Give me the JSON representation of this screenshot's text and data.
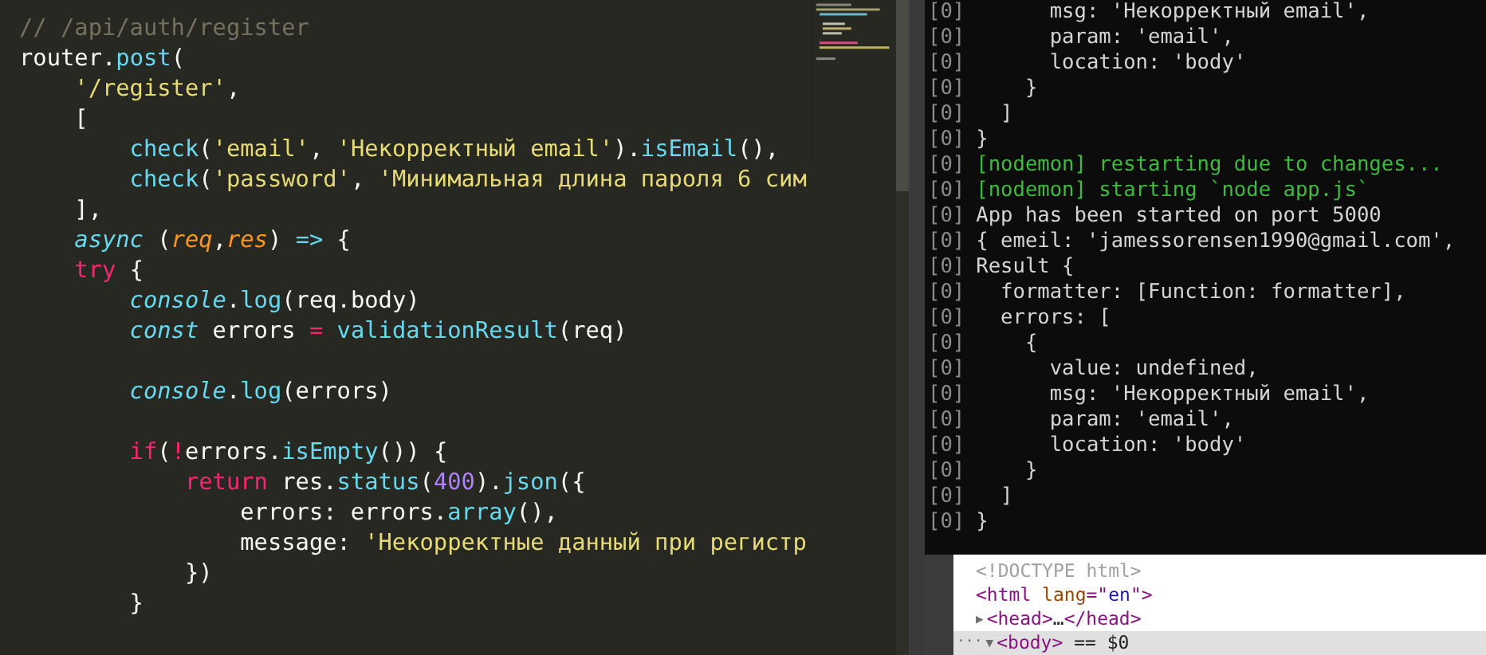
{
  "editor": {
    "lines": [
      {
        "kind": "code",
        "tokens": [
          {
            "kind": "comment",
            "text": "// /api/auth/register"
          }
        ]
      },
      {
        "kind": "code",
        "tokens": [
          {
            "kind": "plain",
            "text": "router."
          },
          {
            "kind": "func",
            "text": "post"
          },
          {
            "kind": "plain",
            "text": "("
          }
        ]
      },
      {
        "kind": "code",
        "tokens": [
          {
            "kind": "string",
            "text": "    '/register'"
          },
          {
            "kind": "plain",
            "text": ","
          }
        ]
      },
      {
        "kind": "code",
        "tokens": [
          {
            "kind": "plain",
            "text": "    ["
          }
        ]
      },
      {
        "kind": "code",
        "tokens": [
          {
            "kind": "func",
            "text": "        check"
          },
          {
            "kind": "plain",
            "text": "("
          },
          {
            "kind": "string",
            "text": "'email'"
          },
          {
            "kind": "plain",
            "text": ", "
          },
          {
            "kind": "string",
            "text": "'Некорректный email'"
          },
          {
            "kind": "plain",
            "text": ")."
          },
          {
            "kind": "func",
            "text": "isEmail"
          },
          {
            "kind": "plain",
            "text": "(),"
          }
        ]
      },
      {
        "kind": "code",
        "tokens": [
          {
            "kind": "func",
            "text": "        check"
          },
          {
            "kind": "plain",
            "text": "("
          },
          {
            "kind": "string",
            "text": "'password'"
          },
          {
            "kind": "plain",
            "text": ", "
          },
          {
            "kind": "string",
            "text": "'Минимальная длина пароля 6 сим"
          }
        ]
      },
      {
        "kind": "code",
        "tokens": [
          {
            "kind": "plain",
            "text": "    ],"
          }
        ]
      },
      {
        "kind": "code",
        "tokens": [
          {
            "kind": "storage",
            "text": "    async"
          },
          {
            "kind": "plain",
            "text": " ("
          },
          {
            "kind": "param",
            "text": "req"
          },
          {
            "kind": "plain",
            "text": ","
          },
          {
            "kind": "param",
            "text": "res"
          },
          {
            "kind": "plain",
            "text": ") "
          },
          {
            "kind": "storage-plain",
            "text": "=>"
          },
          {
            "kind": "plain",
            "text": " {"
          }
        ]
      },
      {
        "kind": "code",
        "tokens": [
          {
            "kind": "keyword",
            "text": "    try"
          },
          {
            "kind": "plain",
            "text": " {"
          }
        ]
      },
      {
        "kind": "code",
        "tokens": [
          {
            "kind": "storage",
            "text": "        console"
          },
          {
            "kind": "plain",
            "text": "."
          },
          {
            "kind": "func",
            "text": "log"
          },
          {
            "kind": "plain",
            "text": "(req.body)"
          }
        ]
      },
      {
        "kind": "code",
        "tokens": [
          {
            "kind": "storage",
            "text": "        const"
          },
          {
            "kind": "plain",
            "text": " errors "
          },
          {
            "kind": "keyword",
            "text": "="
          },
          {
            "kind": "func",
            "text": " validationResult"
          },
          {
            "kind": "plain",
            "text": "(req)"
          }
        ]
      },
      {
        "kind": "blank"
      },
      {
        "kind": "code",
        "tokens": [
          {
            "kind": "storage",
            "text": "        console"
          },
          {
            "kind": "plain",
            "text": "."
          },
          {
            "kind": "func",
            "text": "log"
          },
          {
            "kind": "plain",
            "text": "(errors)"
          }
        ]
      },
      {
        "kind": "blank"
      },
      {
        "kind": "code",
        "tokens": [
          {
            "kind": "keyword",
            "text": "        if"
          },
          {
            "kind": "plain",
            "text": "("
          },
          {
            "kind": "keyword",
            "text": "!"
          },
          {
            "kind": "plain",
            "text": "errors."
          },
          {
            "kind": "func",
            "text": "isEmpty"
          },
          {
            "kind": "plain",
            "text": "()) {"
          }
        ]
      },
      {
        "kind": "code",
        "tokens": [
          {
            "kind": "keyword",
            "text": "            return"
          },
          {
            "kind": "plain",
            "text": " res."
          },
          {
            "kind": "func",
            "text": "status"
          },
          {
            "kind": "plain",
            "text": "("
          },
          {
            "kind": "number",
            "text": "400"
          },
          {
            "kind": "plain",
            "text": ")."
          },
          {
            "kind": "func",
            "text": "json"
          },
          {
            "kind": "plain",
            "text": "({"
          }
        ]
      },
      {
        "kind": "code",
        "tokens": [
          {
            "kind": "plain",
            "text": "                errors: errors."
          },
          {
            "kind": "func",
            "text": "array"
          },
          {
            "kind": "plain",
            "text": "(),"
          }
        ]
      },
      {
        "kind": "code",
        "tokens": [
          {
            "kind": "plain",
            "text": "                message: "
          },
          {
            "kind": "string",
            "text": "'Некорректные данный при регистр"
          }
        ]
      },
      {
        "kind": "code",
        "tokens": [
          {
            "kind": "plain",
            "text": "            })"
          }
        ]
      },
      {
        "kind": "code",
        "tokens": [
          {
            "kind": "plain",
            "text": "        }"
          }
        ]
      }
    ]
  },
  "terminal": {
    "lines": [
      {
        "prefix": "[0]",
        "text": "      msg: 'Некорректный email',",
        "kind": "log"
      },
      {
        "prefix": "[0]",
        "text": "      param: 'email',",
        "kind": "log"
      },
      {
        "prefix": "[0]",
        "text": "      location: 'body'",
        "kind": "log"
      },
      {
        "prefix": "[0]",
        "text": "    }",
        "kind": "log"
      },
      {
        "prefix": "[0]",
        "text": "  ]",
        "kind": "log"
      },
      {
        "prefix": "[0]",
        "text": "}",
        "kind": "log"
      },
      {
        "prefix": "[0]",
        "text": "[nodemon] restarting due to changes...",
        "kind": "nodemon"
      },
      {
        "prefix": "[0]",
        "text": "[nodemon] starting `node app.js`",
        "kind": "nodemon"
      },
      {
        "prefix": "[0]",
        "text": "App has been started on port 5000",
        "kind": "log"
      },
      {
        "prefix": "[0]",
        "text": "{ emeil: 'jamessorensen1990@gmail.com',",
        "kind": "log"
      },
      {
        "prefix": "[0]",
        "text": "Result {",
        "kind": "log"
      },
      {
        "prefix": "[0]",
        "text": "  formatter: [Function: formatter],",
        "kind": "log"
      },
      {
        "prefix": "[0]",
        "text": "  errors: [",
        "kind": "log"
      },
      {
        "prefix": "[0]",
        "text": "    {",
        "kind": "log"
      },
      {
        "prefix": "[0]",
        "text": "      value: undefined,",
        "kind": "log"
      },
      {
        "prefix": "[0]",
        "text": "      msg: 'Некорректный email',",
        "kind": "log"
      },
      {
        "prefix": "[0]",
        "text": "      param: 'email',",
        "kind": "log"
      },
      {
        "prefix": "[0]",
        "text": "      location: 'body'",
        "kind": "log"
      },
      {
        "prefix": "[0]",
        "text": "    }",
        "kind": "log"
      },
      {
        "prefix": "[0]",
        "text": "  ]",
        "kind": "log"
      },
      {
        "prefix": "[0]",
        "text": "}",
        "kind": "log"
      }
    ]
  },
  "devtools": {
    "nodes": [
      {
        "selected": false,
        "tokens": [
          {
            "kind": "doctype",
            "text": "<!DOCTYPE html>"
          }
        ]
      },
      {
        "selected": false,
        "tokens": [
          {
            "kind": "tag",
            "text": "<html "
          },
          {
            "kind": "attr",
            "text": "lang"
          },
          {
            "kind": "tag",
            "text": "=\""
          },
          {
            "kind": "value",
            "text": "en"
          },
          {
            "kind": "tag",
            "text": "\">"
          }
        ]
      },
      {
        "selected": false,
        "toggle": "▶",
        "tokens": [
          {
            "kind": "tag",
            "text": "<head>"
          },
          {
            "kind": "plain",
            "text": "…"
          },
          {
            "kind": "tag",
            "text": "</head>"
          }
        ]
      },
      {
        "selected": true,
        "dots": "···",
        "toggle": "▼",
        "tokens": [
          {
            "kind": "tag",
            "text": "<body>"
          },
          {
            "kind": "plain",
            "text": " == $0"
          }
        ]
      }
    ]
  }
}
